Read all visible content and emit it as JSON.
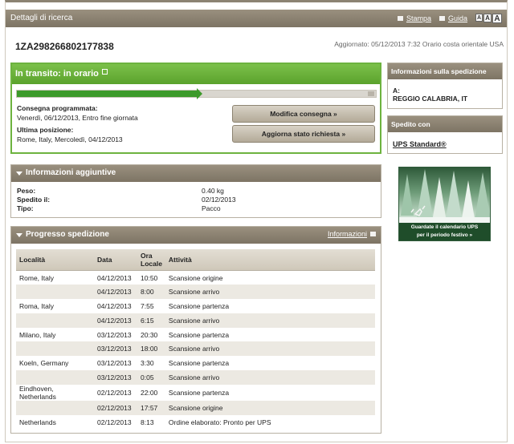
{
  "header": {
    "title": "Dettagli di ricerca",
    "print_label": "Stampa",
    "help_label": "Guida",
    "font_sizes": [
      "A",
      "A",
      "A"
    ]
  },
  "tracking_number": "1ZA298266802177838",
  "updated": "Aggiornato: 05/12/2013 7:32 Orario costa orientale USA",
  "status": {
    "title": "In transito: in orario",
    "progress": 0.5,
    "scheduled_label": "Consegna programmata:",
    "scheduled_value": "Venerdì, 06/12/2013, Entro fine giornata",
    "last_location_label": "Ultima posizione:",
    "last_location_value": "Rome, Italy, Mercoledì, 04/12/2013",
    "modify_button": "Modifica consegna »",
    "refresh_button": "Aggiorna stato richiesta »",
    "accent": "#6db33f"
  },
  "additional": {
    "title": "Informazioni aggiuntive",
    "rows": [
      {
        "label": "Peso:",
        "value": "0.40 kg"
      },
      {
        "label": "Spedito il:",
        "value": "02/12/2013"
      },
      {
        "label": "Tipo:",
        "value": "Pacco"
      }
    ]
  },
  "progress": {
    "title": "Progresso spedizione",
    "info_link": "Informazioni",
    "columns": [
      "Località",
      "Data",
      "Ora Locale",
      "Attività"
    ],
    "rows": [
      [
        "Rome, Italy",
        "04/12/2013",
        "10:50",
        "Scansione origine"
      ],
      [
        "",
        "04/12/2013",
        "8:00",
        "Scansione arrivo"
      ],
      [
        "Roma, Italy",
        "04/12/2013",
        "7:55",
        "Scansione partenza"
      ],
      [
        "",
        "04/12/2013",
        "6:15",
        "Scansione arrivo"
      ],
      [
        "Milano, Italy",
        "03/12/2013",
        "20:30",
        "Scansione partenza"
      ],
      [
        "",
        "03/12/2013",
        "18:00",
        "Scansione arrivo"
      ],
      [
        "Koeln, Germany",
        "03/12/2013",
        "3:30",
        "Scansione partenza"
      ],
      [
        "",
        "03/12/2013",
        "0:05",
        "Scansione arrivo"
      ],
      [
        "Eindhoven, Netherlands",
        "02/12/2013",
        "22:00",
        "Scansione partenza"
      ],
      [
        "",
        "02/12/2013",
        "17:57",
        "Scansione origine"
      ],
      [
        "Netherlands",
        "02/12/2013",
        "8:13",
        "Ordine elaborato: Pronto per UPS"
      ]
    ]
  },
  "sidebar": {
    "shipment_info_title": "Informazioni sulla spedizione",
    "to_label": "A:",
    "to_value": "REGGIO CALABRIA, IT",
    "shipped_with_title": "Spedito con",
    "service_link": "UPS Standard®",
    "ad_text_1": "Guardate il calendario UPS",
    "ad_text_2": "per il periodo festivo »"
  }
}
